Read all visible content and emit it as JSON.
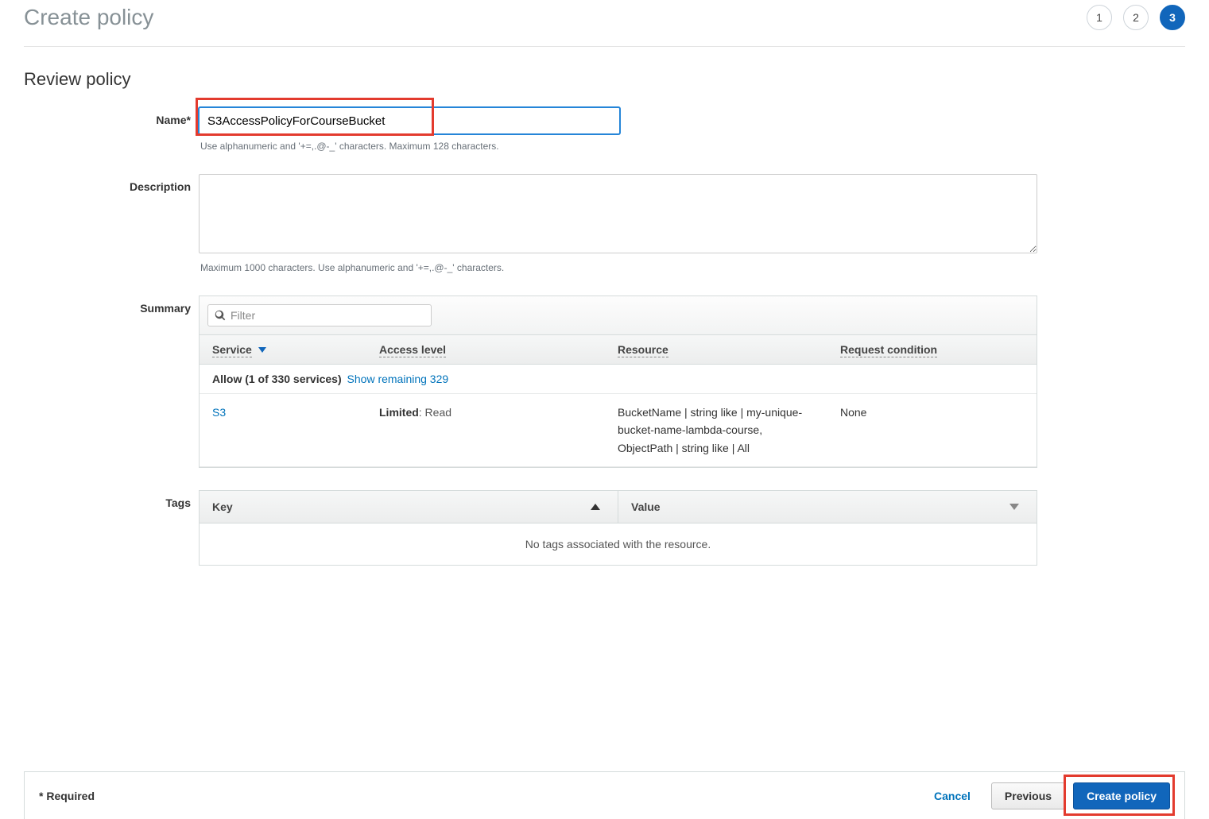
{
  "header": {
    "title": "Create policy",
    "steps": [
      "1",
      "2",
      "3"
    ],
    "active_step_index": 2
  },
  "section_title": "Review policy",
  "name": {
    "label": "Name*",
    "value": "S3AccessPolicyForCourseBucket",
    "hint": "Use alphanumeric and '+=,.@-_' characters. Maximum 128 characters."
  },
  "description": {
    "label": "Description",
    "value": "",
    "hint": "Maximum 1000 characters. Use alphanumeric and '+=,.@-_' characters."
  },
  "summary": {
    "label": "Summary",
    "filter_placeholder": "Filter",
    "columns": {
      "service": "Service",
      "access_level": "Access level",
      "resource": "Resource",
      "request_condition": "Request condition"
    },
    "allow_row": {
      "prefix": "Allow (1 of 330 services)",
      "link": "Show remaining 329"
    },
    "rows": [
      {
        "service": "S3",
        "access_prefix": "Limited",
        "access_suffix": ": Read",
        "resource": "BucketName | string like | my-unique-bucket-name-lambda-course, ObjectPath | string like | All",
        "request_condition": "None"
      }
    ]
  },
  "tags": {
    "label": "Tags",
    "key_col": "Key",
    "value_col": "Value",
    "empty_msg": "No tags associated with the resource."
  },
  "footer": {
    "required": "* Required",
    "cancel": "Cancel",
    "previous": "Previous",
    "create": "Create policy"
  }
}
